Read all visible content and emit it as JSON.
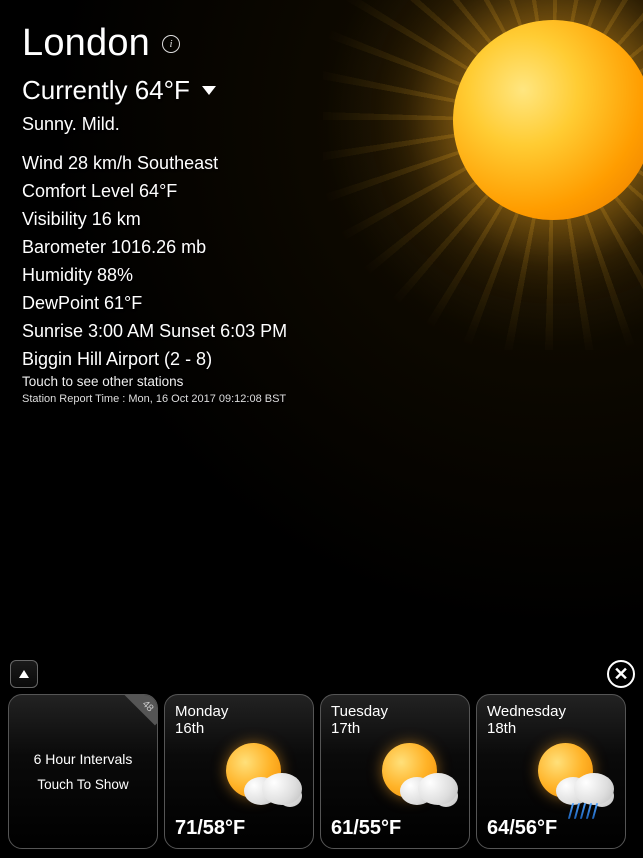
{
  "location": "London",
  "current": {
    "label": "Currently 64°F",
    "condition": "Sunny. Mild."
  },
  "stats": {
    "wind": "Wind 28 km/h Southeast",
    "comfort": "Comfort Level 64°F",
    "visibility": "Visibility 16 km",
    "barometer": "Barometer 1016.26 mb",
    "humidity": "Humidity 88%",
    "dewpoint": "DewPoint 61°F",
    "sun": "Sunrise 3:00 AM Sunset 6:03 PM"
  },
  "station": {
    "name": "Biggin Hill Airport (2 - 8)",
    "hint": "Touch to see other stations",
    "report": "Station Report Time : Mon, 16 Oct 2017 09:12:08 BST"
  },
  "intervals": {
    "title": "6 Hour Intervals",
    "sub": "Touch To Show",
    "badge": "48"
  },
  "forecast": [
    {
      "day": "Monday",
      "date": "16th",
      "temps": "71/58°F",
      "icon": "sun-cloud"
    },
    {
      "day": "Tuesday",
      "date": "17th",
      "temps": "61/55°F",
      "icon": "sun-cloud"
    },
    {
      "day": "Wednesday",
      "date": "18th",
      "temps": "64/56°F",
      "icon": "sun-cloud-rain"
    }
  ],
  "close_label": "✕"
}
